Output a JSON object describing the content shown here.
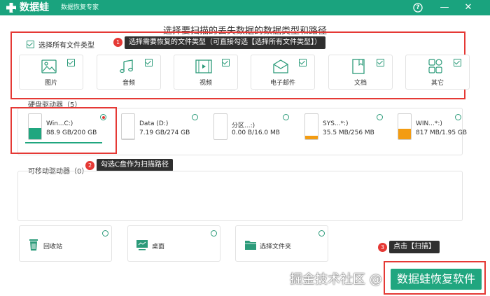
{
  "titlebar": {
    "app_name": "数据蛙",
    "app_subtitle": "数据恢复专家",
    "help_glyph": "?",
    "minimize_glyph": "—",
    "close_glyph": "✕",
    "accent": "#1aa37e"
  },
  "page_title": "选择要扫描的丢失数据的数据类型和路径",
  "file_types": {
    "select_all_label": "选择所有文件类型",
    "select_all_checked": true,
    "items": [
      {
        "label": "图片",
        "icon": "image-icon",
        "checked": true
      },
      {
        "label": "音频",
        "icon": "music-icon",
        "checked": true
      },
      {
        "label": "视频",
        "icon": "video-icon",
        "checked": true
      },
      {
        "label": "电子邮件",
        "icon": "email-icon",
        "checked": true
      },
      {
        "label": "文档",
        "icon": "document-icon",
        "checked": true
      },
      {
        "label": "其它",
        "icon": "other-icon",
        "checked": true
      }
    ]
  },
  "hard_drives": {
    "label": "硬盘驱动器（5）",
    "items": [
      {
        "name": "Win...C:)",
        "size": "88.9 GB/200 GB",
        "selected": true,
        "fill": 0.44
      },
      {
        "name": "Data (D:)",
        "size": "7.19 GB/274 GB",
        "selected": false,
        "fill": 0.03
      },
      {
        "name": "分区...:)",
        "size": "0.00  B/16.0 MB",
        "selected": false,
        "fill": 0.0
      },
      {
        "name": "SYS...*:)",
        "size": "35.5 MB/256 MB",
        "selected": false,
        "fill": 0.14
      },
      {
        "name": "WIN...*:)",
        "size": "817 MB/1.95 GB",
        "selected": false,
        "fill": 0.42
      }
    ]
  },
  "removable": {
    "label": "可移动驱动器（0）"
  },
  "locations": [
    {
      "label": "回收站",
      "icon": "recycle-bin-icon"
    },
    {
      "label": "桌面",
      "icon": "desktop-icon"
    },
    {
      "label": "选择文件夹",
      "icon": "folder-icon"
    }
  ],
  "annotations": [
    {
      "number": "1",
      "text": "选择需要恢复的文件类型（可直接勾选【选择所有文件类型】）"
    },
    {
      "number": "2",
      "text": "勾选C盘作为扫描路径"
    },
    {
      "number": "3",
      "text": "点击【扫描】"
    }
  ],
  "scan_button_label": "数据蛙恢复软件",
  "watermark": "掘金技术社区 @",
  "colors": {
    "annotation_red": "#e53935",
    "drive_fill": "#f39c12",
    "brand_green": "#20a67f"
  }
}
